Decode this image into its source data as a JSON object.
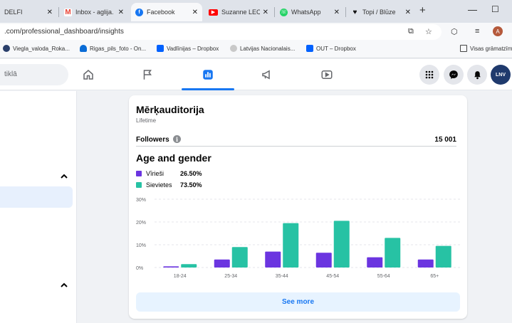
{
  "browser": {
    "tabs": [
      {
        "title": "DELFI",
        "favicon": "delfi-icon"
      },
      {
        "title": "Inbox - aglija.",
        "favicon": "gmail-icon",
        "color": "#ea4335"
      },
      {
        "title": "Facebook",
        "favicon": "facebook-icon",
        "color": "#1877f2"
      },
      {
        "title": "Suzanne LEC",
        "favicon": "youtube-icon",
        "color": "#ff0000"
      },
      {
        "title": "WhatsApp",
        "favicon": "whatsapp-icon",
        "color": "#25d366"
      },
      {
        "title": "Topi / Blūze",
        "favicon": "heart-icon",
        "color": "#111111"
      }
    ],
    "url": ".com/professional_dashboard/insights",
    "bookmarks": [
      {
        "label": "Viegla_valoda_Roka...",
        "icon": "bookmark-site-icon"
      },
      {
        "label": "Rigas_pils_foto - On...",
        "icon": "onedrive-icon"
      },
      {
        "label": "Vadlīnijas – Dropbox",
        "icon": "dropbox-icon"
      },
      {
        "label": "Latvijas Nacionalais...",
        "icon": "library-icon"
      },
      {
        "label": "OUT – Dropbox",
        "icon": "dropbox-icon"
      },
      {
        "label": "Visas grāmatzīm",
        "icon": "folder-icon"
      }
    ],
    "avatar_letter": "A"
  },
  "fb": {
    "search_placeholder": "tiklā",
    "profile_initials": "LNV"
  },
  "card": {
    "title": "Mērķauditorija",
    "subtitle": "Lifetime",
    "followers_label": "Followers",
    "followers_value": "15 001",
    "section_title": "Age and gender",
    "legend": [
      {
        "name": "Vīrieši",
        "pct": "26.50%",
        "color": "#6b35e0"
      },
      {
        "name": "Sievietes",
        "pct": "73.50%",
        "color": "#27c2a4"
      }
    ],
    "see_more": "See more"
  },
  "chart_data": {
    "type": "bar",
    "categories": [
      "18-24",
      "25-34",
      "35-44",
      "45-54",
      "55-64",
      "65+"
    ],
    "series": [
      {
        "name": "Vīrieši",
        "color": "#6b35e0",
        "values": [
          0.5,
          3.5,
          7,
          6.5,
          4.5,
          3.5
        ]
      },
      {
        "name": "Sievietes",
        "color": "#27c2a4",
        "values": [
          1.5,
          9,
          19.5,
          20.5,
          13,
          9.5
        ]
      }
    ],
    "ylim": [
      0,
      30
    ],
    "yticks": [
      "0%",
      "10%",
      "20%",
      "30%"
    ],
    "grid": true
  }
}
